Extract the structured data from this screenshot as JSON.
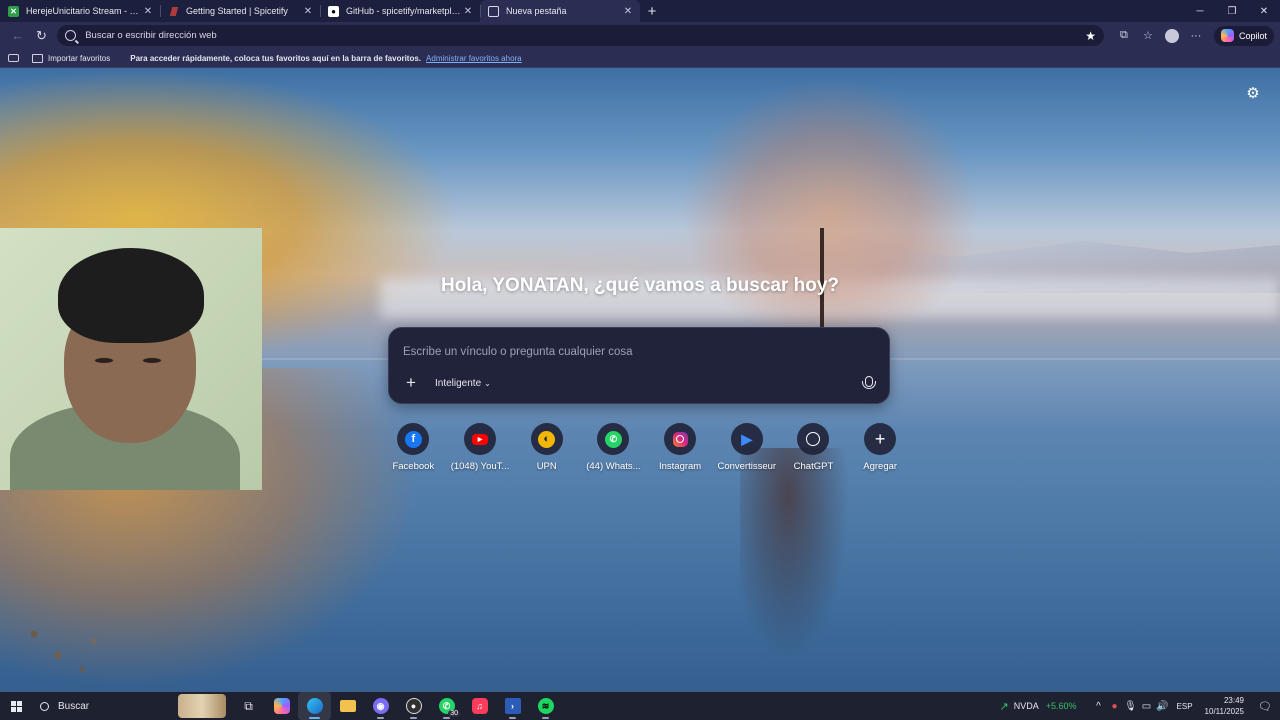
{
  "browser": {
    "tabs": [
      {
        "title": "HerejeUnicitario Stream - Watch",
        "favicon": "green-square-icon",
        "active": false
      },
      {
        "title": "Getting Started | Spicetify",
        "favicon": "spicetify-icon",
        "active": false
      },
      {
        "title": "GitHub - spicetify/marketplace: D",
        "favicon": "github-icon",
        "active": false
      },
      {
        "title": "Nueva pestaña",
        "favicon": "new-tab-icon",
        "active": true
      }
    ],
    "address_placeholder": "Buscar o escribir dirección web",
    "copilot_label": "Copilot"
  },
  "favorites_bar": {
    "import_label": "Importar favoritos",
    "message": "Para acceder rápidamente, coloca tus favoritos aquí en la barra de favoritos.",
    "manage_link": "Administrar favoritos ahora"
  },
  "ntp": {
    "greeting": "Hola, YONATAN, ¿qué vamos a buscar hoy?",
    "search_placeholder": "Escribe un vínculo o pregunta cualquier cosa",
    "mode_label": "Inteligente",
    "quick_links": [
      {
        "label": "Facebook",
        "icon": "facebook-icon"
      },
      {
        "label": "(1048) YouT...",
        "icon": "youtube-icon"
      },
      {
        "label": "UPN",
        "icon": "upn-icon"
      },
      {
        "label": "(44) Whats...",
        "icon": "whatsapp-icon"
      },
      {
        "label": "Instagram",
        "icon": "instagram-icon"
      },
      {
        "label": "Convertisseur",
        "icon": "convertisseur-icon"
      },
      {
        "label": "ChatGPT",
        "icon": "chatgpt-icon"
      },
      {
        "label": "Agregar",
        "icon": "add-icon"
      }
    ]
  },
  "taskbar": {
    "search_label": "Buscar",
    "whatsapp_badge": "30",
    "stock_ticker": "NVDA",
    "stock_change": "+5.60%",
    "language": "ESP",
    "time": "23:49",
    "date": "10/11/2025"
  },
  "colors": {
    "tab_strip": "#1d1f3e",
    "toolbar": "#2b2d52",
    "search_box": "#20233a",
    "link": "#7fb2ff",
    "stock_up": "#35c26b",
    "taskbar": "#1e2130"
  }
}
